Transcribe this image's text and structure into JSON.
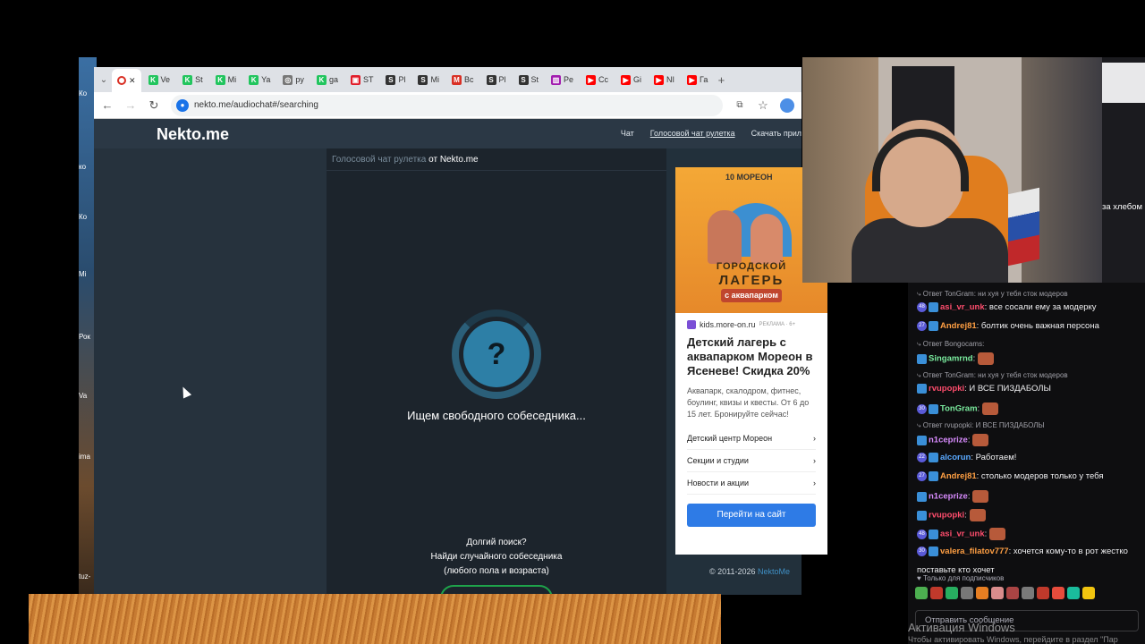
{
  "browser": {
    "tabs": [
      {
        "label": "Ve",
        "color": "#22c55e",
        "glyph": "K"
      },
      {
        "label": "St",
        "color": "#22c55e",
        "glyph": "K"
      },
      {
        "label": "Mi",
        "color": "#22c55e",
        "glyph": "K"
      },
      {
        "label": "Ya",
        "color": "#22c55e",
        "glyph": "K"
      },
      {
        "label": "py",
        "color": "#777777",
        "glyph": "◎"
      },
      {
        "label": "ga",
        "color": "#22c55e",
        "glyph": "K"
      },
      {
        "label": "ST",
        "color": "#e11d2a",
        "glyph": "▣"
      },
      {
        "label": "Pl",
        "color": "#333333",
        "glyph": "S"
      },
      {
        "label": "Mi",
        "color": "#333333",
        "glyph": "S"
      },
      {
        "label": "Bc",
        "color": "#d93025",
        "glyph": "M"
      },
      {
        "label": "Pl",
        "color": "#333333",
        "glyph": "S"
      },
      {
        "label": "St",
        "color": "#333333",
        "glyph": "S"
      },
      {
        "label": "Pe",
        "color": "#a21caf",
        "glyph": "▥"
      },
      {
        "label": "Cc",
        "color": "#ff0000",
        "glyph": "▶"
      },
      {
        "label": "Gi",
        "color": "#ff0000",
        "glyph": "▶"
      },
      {
        "label": "NI",
        "color": "#ff0000",
        "glyph": "▶"
      },
      {
        "label": "Га",
        "color": "#ff0000",
        "glyph": "▶"
      }
    ],
    "url": "nekto.me/audiochat#/searching"
  },
  "site": {
    "logo": "Nekto.me",
    "menu": [
      "Чат",
      "Голосовой чат рулетка",
      "Скачать прил"
    ],
    "crumb_link": "Голосовой чат рулетка",
    "crumb_rest": " от Nekto.me",
    "question": "?",
    "status": "Ищем свободного собеседника...",
    "long_search": [
      "Долгий поиск?",
      "Найди случайного собеседника",
      "(любого пола и возраста)"
    ],
    "copyright": "© 2011-2026 ",
    "copyright_link": "NektoMe"
  },
  "ad": {
    "brand": "10 МОРЕОН",
    "camp_a": "ГОРОДСКОЙ",
    "camp_b": "ЛАГЕРЬ",
    "camp_c": "с аквапарком",
    "domain": "kids.more-on.ru",
    "label": "РЕКЛАМА · 6+",
    "title": "Детский лагерь с аквапарком Мореон в Ясеневе! Скидка 20%",
    "desc": "Аквапарк, скалодром, фитнес, боулинг, квизы и квесты. От 6 до 15 лет. Бронируйте сейчас!",
    "links": [
      "Детский центр Мореон",
      "Секции и студии",
      "Новости и акции"
    ],
    "button": "Перейти на сайт"
  },
  "chat": {
    "side_text": "за хлебом",
    "messages": [
      {
        "type": "reply",
        "text": "⤷ Ответ TonGram: ни хуя у тебя сток модеров"
      },
      {
        "type": "msg",
        "badge": "48",
        "nick": "asi_vr_unk",
        "color": "#ff4d6d",
        "text": ": все сосали ему за модерку"
      },
      {
        "type": "msg",
        "badge": "27",
        "nick": "Andrej81",
        "color": "#ff9f43",
        "text": ": болтик очень важная персона"
      },
      {
        "type": "reply",
        "text": "⤷ Ответ Bongocams:"
      },
      {
        "type": "msg",
        "badge": "",
        "nick": "Singamrnd",
        "color": "#7bed9f",
        "text": ":"
      },
      {
        "type": "reply",
        "text": "⤷ Ответ TonGram: ни хуя у тебя сток модеров"
      },
      {
        "type": "msg",
        "badge": "",
        "nick": "rvupopki",
        "color": "#ff4d6d",
        "text": ": И ВСЕ ПИЗДАБОЛЫ"
      },
      {
        "type": "msg",
        "badge": "30",
        "nick": "TonGram",
        "color": "#7bed9f",
        "text": ":"
      },
      {
        "type": "reply",
        "text": "⤷ Ответ rvupopki: И ВСЕ ПИЗДАБОЛЫ"
      },
      {
        "type": "msg",
        "badge": "",
        "nick": "n1ceprize",
        "color": "#d98cff",
        "text": ":"
      },
      {
        "type": "msg",
        "badge": "22",
        "nick": "alcorun",
        "color": "#5aa9ff",
        "text": ": Работаем!"
      },
      {
        "type": "msg",
        "badge": "27",
        "nick": "Andrej81",
        "color": "#ff9f43",
        "text": ": столько модеров только у тебя"
      },
      {
        "type": "msg",
        "badge": "",
        "nick": "n1ceprize",
        "color": "#d98cff",
        "text": ":"
      },
      {
        "type": "msg",
        "badge": "",
        "nick": "rvupopki",
        "color": "#ff4d6d",
        "text": ":"
      },
      {
        "type": "msg",
        "badge": "48",
        "nick": "asi_vr_unk",
        "color": "#ff4d6d",
        "text": ":"
      },
      {
        "type": "msg",
        "badge": "30",
        "nick": "valera_filatov777",
        "color": "#ff9f43",
        "text": ": хочется кому-то в рот жестко"
      },
      {
        "type": "cont",
        "text": "поставьте кто хочет"
      }
    ],
    "subs_only": "♥ Только для подписчиков",
    "input_placeholder": "Отправить сообщение"
  },
  "windows": {
    "activation_title": "Активация Windows",
    "activation_text": "Чтобы активировать Windows, перейдите в раздел \"Пар"
  },
  "desktop_labels": [
    "Ко",
    "ко",
    "Ко",
    "Mi",
    "Рок",
    "Va",
    "ima",
    "tuz-"
  ]
}
